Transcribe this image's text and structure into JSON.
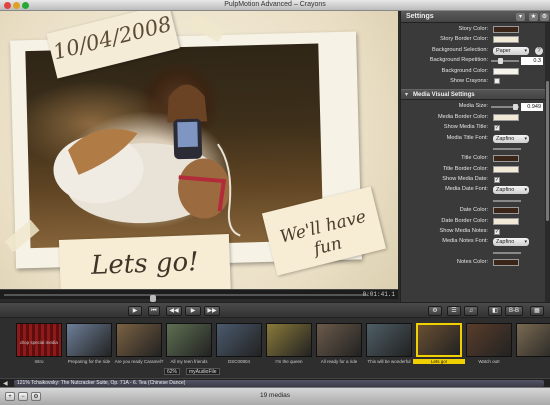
{
  "window": {
    "title": "PulpMotion Advanced – Crayons"
  },
  "preview": {
    "date_text": "10/04/2008",
    "caption_text": "Lets go!",
    "secondary_text": "We'll have fun",
    "time": "0:01:41.1"
  },
  "settings": {
    "title": "Settings",
    "top_rows": [
      {
        "label": "Story Color:",
        "type": "swatch",
        "color": "#3b2418"
      },
      {
        "label": "Story Border Color:",
        "type": "swatch",
        "color": "#f2ead6"
      },
      {
        "label": "Background Selection:",
        "type": "select",
        "value": "Paper"
      },
      {
        "label": "Background Repetition:",
        "type": "slider",
        "value": "0.3"
      },
      {
        "label": "Background Color:",
        "type": "swatch",
        "color": "#f6f3ea"
      },
      {
        "label": "Show Crayons:",
        "type": "checkbox",
        "checked": false
      }
    ],
    "media_section": "Media Visual Settings",
    "media_rows": [
      {
        "label": "Media Size:",
        "type": "slider",
        "value": "0.949"
      },
      {
        "label": "Media Border Color:",
        "type": "swatch",
        "color": "#f2ead6"
      },
      {
        "label": "Show Media Title:",
        "type": "checkbox",
        "checked": true
      },
      {
        "label": "Media Title Font:",
        "type": "select",
        "value": "Zapfino"
      },
      {
        "label": "",
        "type": "spacer"
      },
      {
        "label": "Title Color:",
        "type": "swatch",
        "color": "#3b2418"
      },
      {
        "label": "Title Border Color:",
        "type": "swatch",
        "color": "#f2ead6"
      },
      {
        "label": "Show Media Date:",
        "type": "checkbox",
        "checked": true
      },
      {
        "label": "Media Date Font:",
        "type": "select",
        "value": "Zapfino"
      },
      {
        "label": "",
        "type": "spacer"
      },
      {
        "label": "Date Color:",
        "type": "swatch",
        "color": "#3b2418"
      },
      {
        "label": "Date Border Color:",
        "type": "swatch",
        "color": "#f2ead6"
      },
      {
        "label": "Show Media Notes:",
        "type": "checkbox",
        "checked": true
      },
      {
        "label": "Media Notes Font:",
        "type": "select",
        "value": "Zapfino"
      },
      {
        "label": "",
        "type": "spacer"
      },
      {
        "label": "Notes Color:",
        "type": "swatch",
        "color": "#3b2418"
      }
    ]
  },
  "thumbnails": [
    {
      "label": "drop special media",
      "sub": "Intro",
      "color": "#8e1a1a"
    },
    {
      "label": "Preparing for the ride",
      "color": "#6d7f98"
    },
    {
      "label": "Are you ready Caramel?",
      "color": "#7b6243"
    },
    {
      "label": "All my teen friends",
      "color": "#5e6f52"
    },
    {
      "label": "DSC00804",
      "color": "#4b5a6e"
    },
    {
      "label": "I'm the queen",
      "color": "#8a7a3a"
    },
    {
      "label": "All ready for a ride",
      "color": "#6b5a4a"
    },
    {
      "label": "This will be wonderful",
      "color": "#4e5e66"
    },
    {
      "label": "Lets go!",
      "color": "#6a4f32",
      "selected": true
    },
    {
      "label": "Watch out!",
      "color": "#5a3d2a"
    },
    {
      "label": "",
      "color": "#7a6a52"
    }
  ],
  "strip_zoom": "62%",
  "strip_name": "myAudioFile",
  "audio": {
    "text": "121% Tchaikovsky: The Nutcracker Suite, Op. 71A - 6. Tea (Chinese Dance)"
  },
  "status": {
    "text": "19 medias"
  },
  "toolbar": {
    "play_label": "▶",
    "prev_label": "◀◀",
    "play2_label": "▶",
    "next_label": "▶▶",
    "list_label": "☰",
    "b_label": "B-B",
    "grid_label": "▦"
  }
}
